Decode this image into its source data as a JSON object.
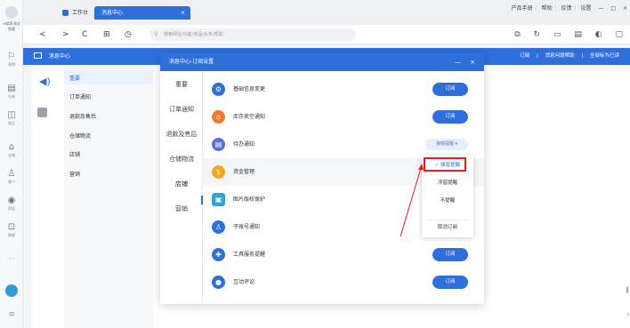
{
  "rail": {
    "store_label": "ai商家测试",
    "store_sub": "铁蕾",
    "items": [
      {
        "label": "营销",
        "icon": "megaphone-icon",
        "glyph": "⚐"
      },
      {
        "label": "交易",
        "icon": "order-icon",
        "glyph": "▤"
      },
      {
        "label": "商品",
        "icon": "goods-icon",
        "glyph": "◫"
      },
      {
        "label": "店铺",
        "icon": "shop-icon",
        "glyph": "⌂"
      },
      {
        "label": "客户",
        "icon": "customer-icon",
        "glyph": "♙"
      },
      {
        "label": "资金",
        "icon": "money-icon",
        "glyph": "◉"
      },
      {
        "label": "数据",
        "icon": "data-icon",
        "glyph": "⊡"
      }
    ],
    "more": "···",
    "menu": "≡"
  },
  "tabs": {
    "home": "工作台",
    "active": "消息中心",
    "close": "×"
  },
  "topright": {
    "links": [
      "产品手册",
      "帮助",
      "反馈",
      "设置"
    ],
    "min": "—",
    "max": "□",
    "close": "×"
  },
  "addressbar": {
    "back": "<",
    "forward": ">",
    "refresh": "C",
    "placeholder": "搜索网址/功能/商品/头条/帮助"
  },
  "msgbar": {
    "title": "消息中心",
    "right_items": [
      "订阅",
      "|",
      "消息问题帮助",
      "|",
      "全部标为已读"
    ]
  },
  "bgmenu": [
    "重要",
    "订单通知",
    "退款及售后",
    "仓储物流",
    "店铺",
    "营销"
  ],
  "dialog": {
    "title": "消息中心-订阅设置",
    "minimize": "—",
    "close": "×",
    "side": [
      "重要",
      "订单通知",
      "退款及售后",
      "仓储物流",
      "店铺",
      "营销"
    ],
    "rows": [
      {
        "label": "基础信息变更",
        "action": "订阅",
        "type": "button",
        "color": "#2f6fdb",
        "glyph": "⚙"
      },
      {
        "label": "库存卖空通知",
        "action": "订阅",
        "type": "button",
        "color": "#f07a2d",
        "glyph": "⌂"
      },
      {
        "label": "待办通知",
        "action": "弹窗提醒 ▾",
        "type": "pill",
        "color": "#5b6ee0",
        "glyph": "▤"
      },
      {
        "label": "资金管理",
        "action": "",
        "type": "none",
        "color": "#f5a623",
        "glyph": "$"
      },
      {
        "label": "图片版权保护",
        "action": "",
        "type": "none",
        "color": "#2fa6d9",
        "glyph": "▣"
      },
      {
        "label": "子账号通知",
        "action": "",
        "type": "none",
        "color": "#2f6fdb",
        "glyph": "♙"
      },
      {
        "label": "工具服务提醒",
        "action": "订阅",
        "type": "button",
        "color": "#2f6fdb",
        "glyph": "✚"
      },
      {
        "label": "互动评论",
        "action": "订阅",
        "type": "button",
        "color": "#2f6fdb",
        "glyph": "●"
      }
    ]
  },
  "dropdown": {
    "items": [
      "✓ 弹窗提醒",
      "浮窗提醒",
      "不提醒",
      "取消订阅"
    ]
  }
}
